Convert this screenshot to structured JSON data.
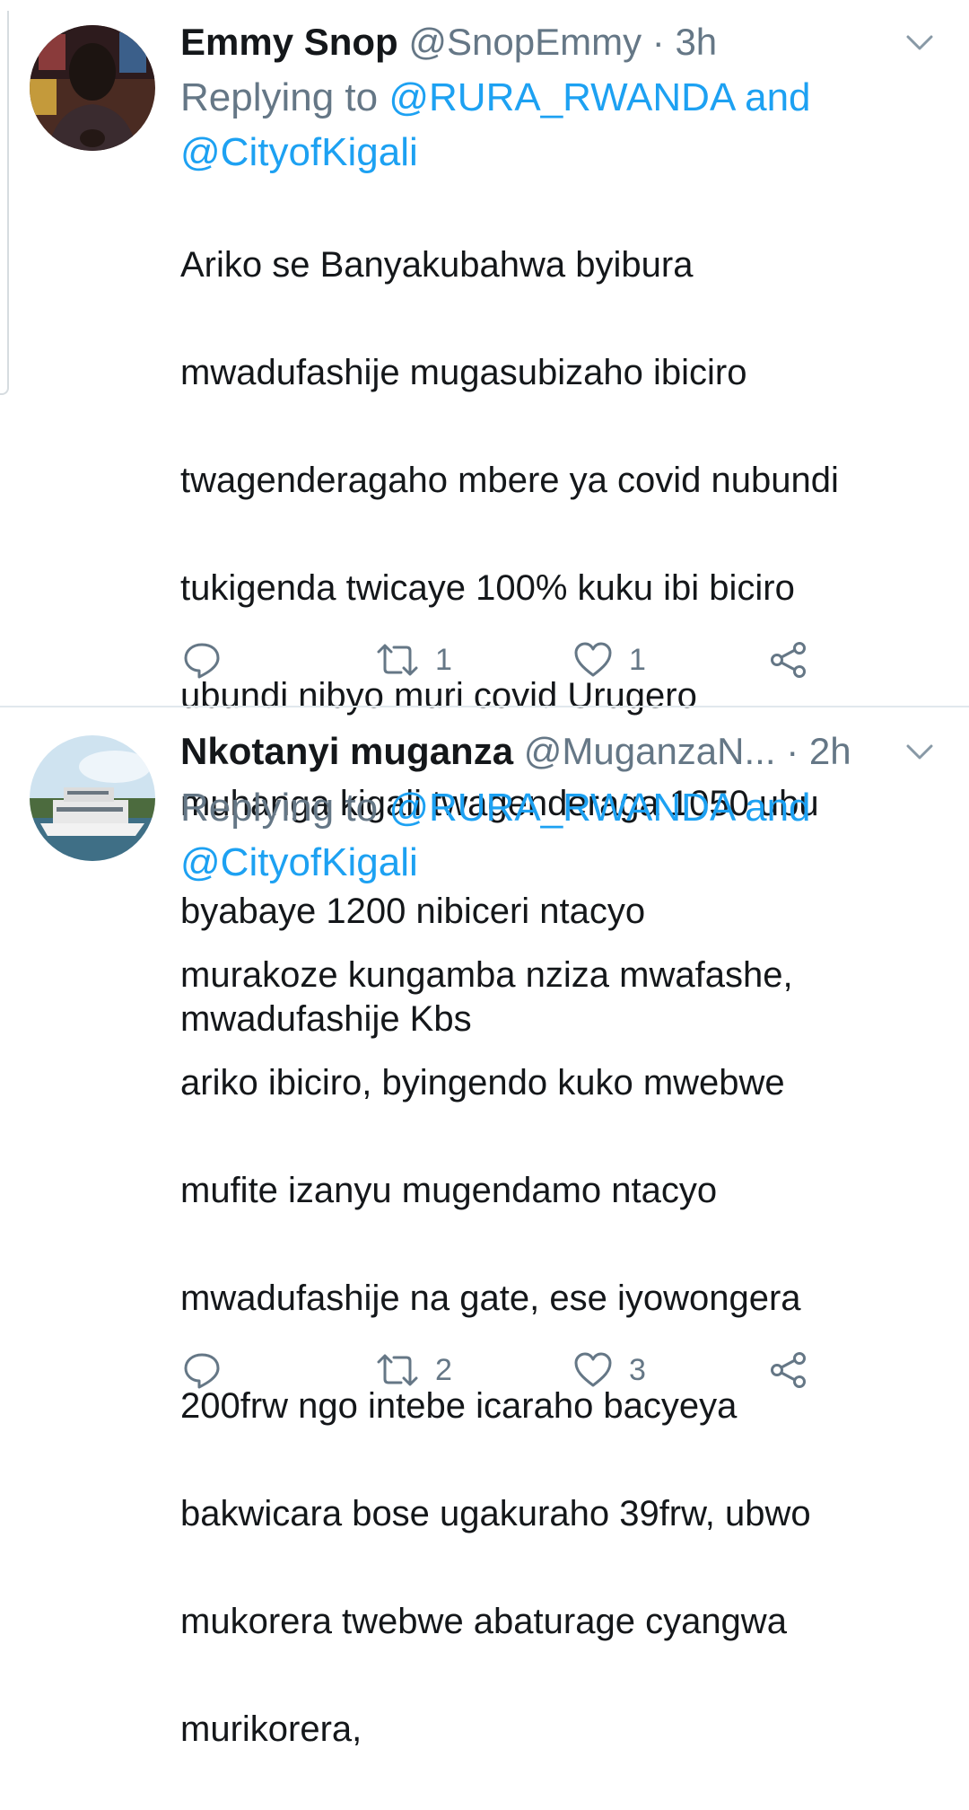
{
  "tweets": [
    {
      "name": "Emmy Snop",
      "handle": "@SnopEmmy",
      "separator": "·",
      "time": "3h",
      "replying_prefix": "Replying to ",
      "mention_1": "@RURA_RWANDA",
      "mention_and": " and",
      "mention_2": "@CityofKigali",
      "lines": [
        "Ariko se Banyakubahwa byibura",
        "mwadufashije mugasubizaho ibiciro",
        "twagenderagaho mbere ya covid nubundi",
        "tukigenda twicaye 100% kuku ibi biciro",
        "ubundi nibyo muri covid Urugero",
        "muhanga kigali twagenderaga 1050 ubu",
        "byabaye 1200 nibiceri ntacyo",
        "mwadufashije Kbs"
      ],
      "retweets": "1",
      "likes": "1",
      "avatar_icon": "avatar-photo-person"
    },
    {
      "name": "Nkotanyi muganza",
      "handle": "@MuganzaN...",
      "separator": "·",
      "time": "2h",
      "replying_prefix": "Replying to ",
      "mention_1": "@RURA_RWANDA",
      "mention_and": " and",
      "mention_2": "@CityofKigali",
      "lines": [
        "murakoze kungamba nziza mwafashe,",
        "ariko ibiciro, byingendo kuko mwebwe",
        "mufite izanyu mugendamo ntacyo",
        "mwadufashije na gate, ese iyowongera",
        "200frw ngo intebe icaraho bacyeya",
        "bakwicara bose ugakuraho 39frw, ubwo",
        "mukorera twebwe abaturage cyangwa",
        "murikorera,"
      ],
      "retweets": "2",
      "likes": "3",
      "avatar_icon": "avatar-photo-boat"
    }
  ],
  "icons": {
    "reply": "reply-icon",
    "retweet": "retweet-icon",
    "like": "heart-icon",
    "share": "share-icon",
    "caret": "chevron-down-icon"
  },
  "colors": {
    "text": "#14171a",
    "secondary": "#657786",
    "link": "#1da1f2",
    "divider": "#e1e8ed"
  }
}
